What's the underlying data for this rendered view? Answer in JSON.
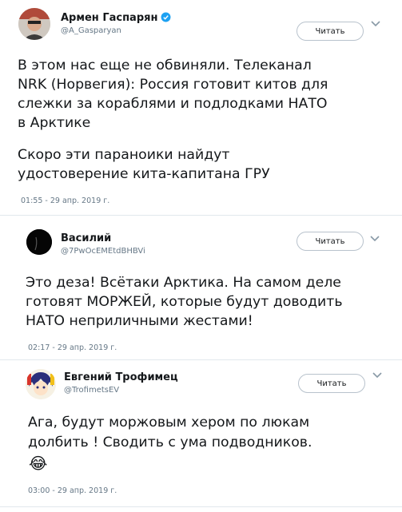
{
  "colors": {
    "text": "#14171a",
    "muted": "#657786",
    "divider": "#e1e8ed",
    "verified": "#1da1f2",
    "button_border": "#b8c2cc"
  },
  "tweets": [
    {
      "name": "Армен Гаспарян",
      "handle": "@A_Gasparyan",
      "follow_label": "Читать",
      "verified": true,
      "paragraphs": [
        [
          "В этом нас еще не обвиняли. Телеканал",
          "NRK (Норвегия):  Россия готовит китов для",
          "слежки за кораблями и подлодками НАТО",
          "в Арктике"
        ],
        [
          "Скоро эти параноики найдут",
          "удостоверение кита-капитана ГРУ"
        ]
      ],
      "timestamp": "01:55 - 29 апр. 2019 г."
    },
    {
      "name": "Василий",
      "handle": "@7PwOcEMEtdBHBVi",
      "follow_label": "Читать",
      "verified": false,
      "paragraphs": [
        [
          "Это деза! Всётаки Арктика. На самом деле",
          "готовят МОРЖЕЙ, которые будут доводить",
          "НАТО неприличными жестами!"
        ]
      ],
      "timestamp": "02:17 - 29 апр. 2019 г."
    },
    {
      "name": "Евгений Трофимец",
      "handle": "@TrofimetsEV",
      "follow_label": "Читать",
      "verified": false,
      "paragraphs": [
        [
          "Ага, будут моржовым хером по люкам",
          "долбить ! Сводить с ума подводников."
        ]
      ],
      "emoji": "😂",
      "timestamp": "03:00 - 29 апр. 2019 г."
    }
  ]
}
